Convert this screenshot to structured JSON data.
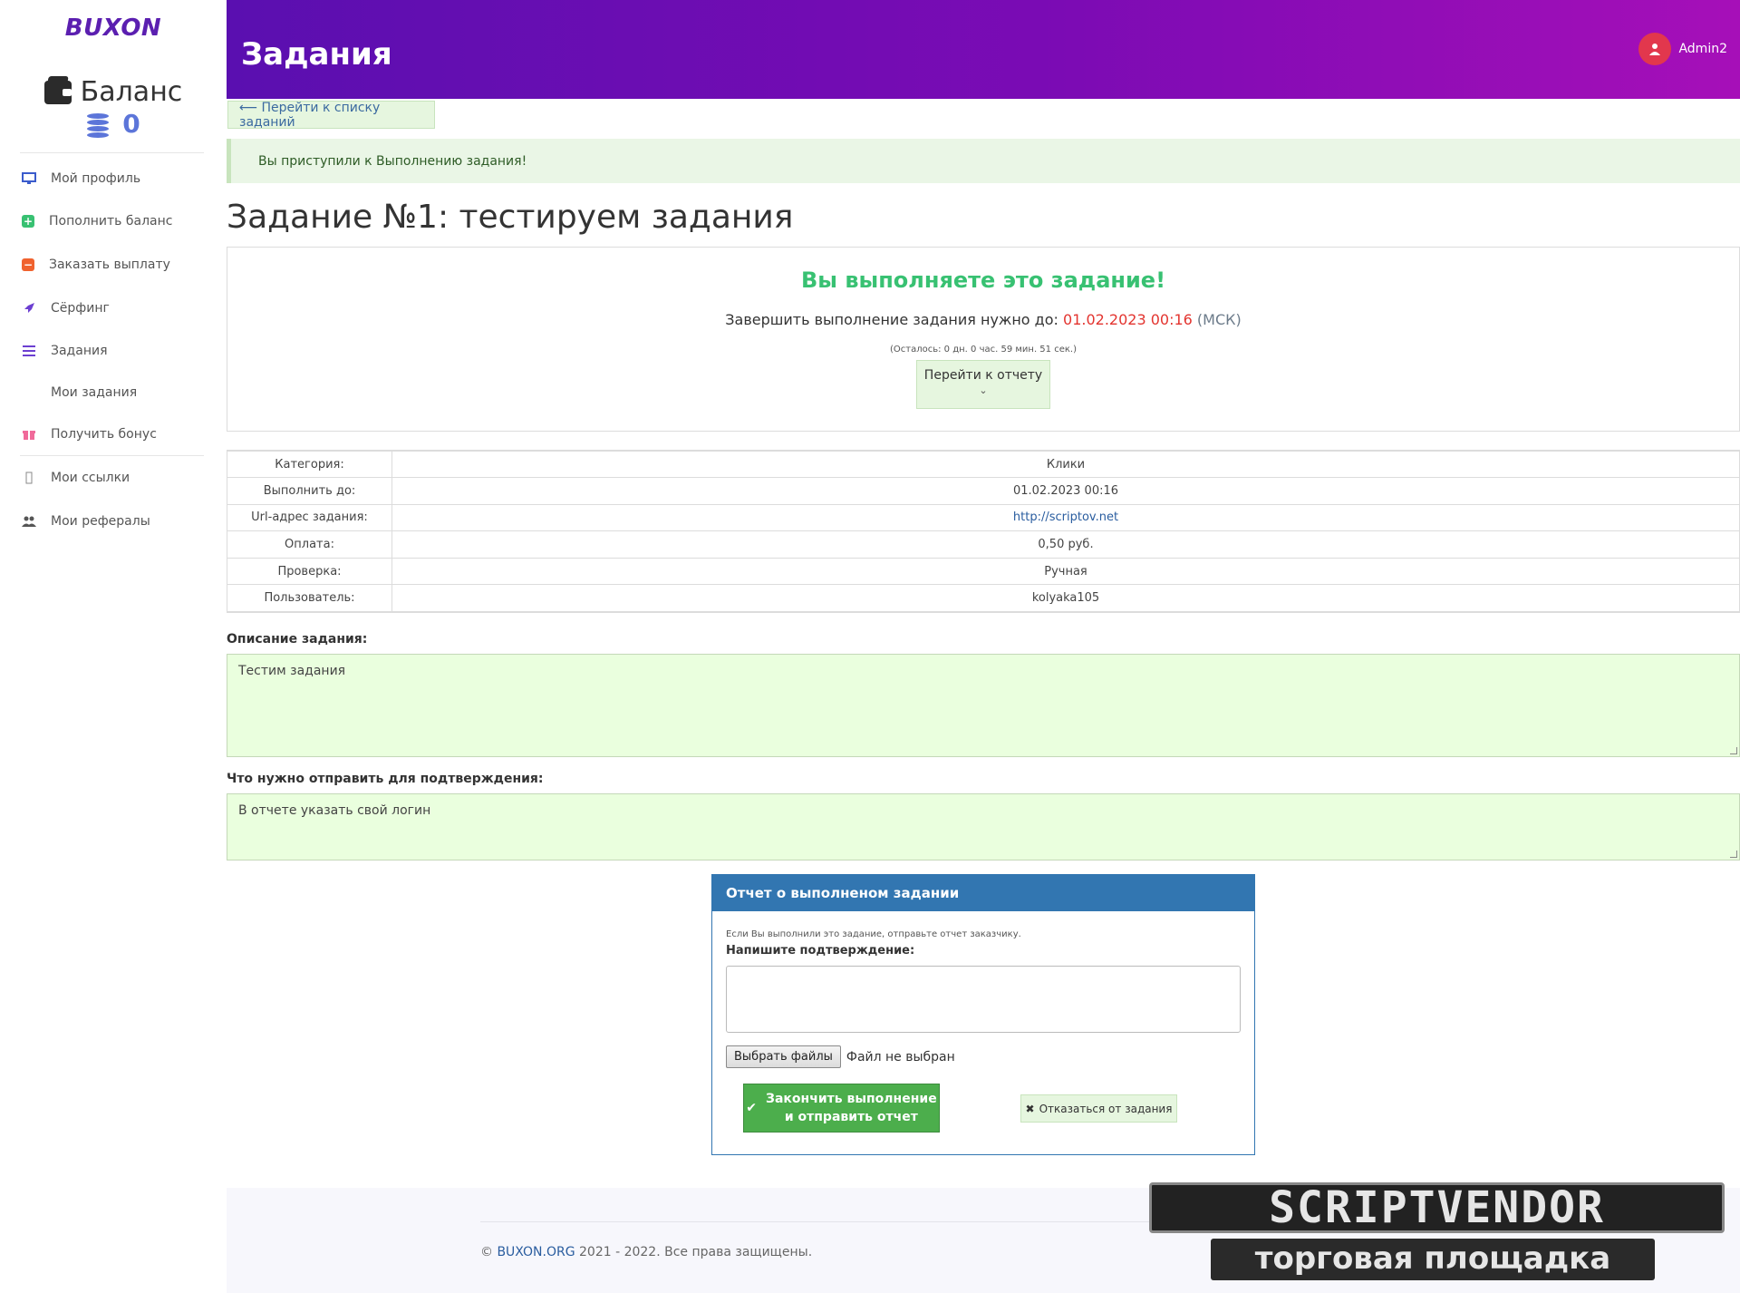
{
  "brand": {
    "logo": "BUXON"
  },
  "balance": {
    "title": "Баланс",
    "value": "0"
  },
  "sidebar": {
    "items": [
      {
        "label": "Мой профиль",
        "icon": "monitor-icon",
        "color": "#3b5ccc"
      },
      {
        "label": "Пополнить баланс",
        "icon": "plus-square-icon",
        "color": "#38c172"
      },
      {
        "label": "Заказать выплату",
        "icon": "minus-square-icon",
        "color": "#f0622e"
      },
      {
        "label": "Сёрфинг",
        "icon": "rocket-icon",
        "color": "#6c3fd1"
      },
      {
        "label": "Задания",
        "icon": "list-icon",
        "color": "#6c3fd1"
      },
      {
        "label": "Мои задания",
        "icon": "",
        "color": ""
      },
      {
        "label": "Получить бонус",
        "icon": "gift-icon",
        "color": "#f06a9a"
      },
      {
        "label": "Мои ссылки",
        "icon": "link-icon",
        "color": "#888888"
      },
      {
        "label": "Мои рефералы",
        "icon": "users-icon",
        "color": "#555555"
      }
    ]
  },
  "header": {
    "title": "Задания",
    "user": "Admin2"
  },
  "back_link": "⟵ Перейти к списку заданий",
  "alert": "Вы приступили к Выполнению задания!",
  "task": {
    "title": "Задание №1: тестируем задания",
    "status": "Вы выполняете это задание!",
    "deadline_prefix": "Завершить выполнение задания нужно до:",
    "deadline": "01.02.2023 00:16",
    "tz": "(МСК)",
    "remaining": "(Осталось: 0 дн. 0 час.  59 мин.  51 сек.)",
    "report_link": "Перейти к отчету"
  },
  "info_table": [
    {
      "key": "Категория:",
      "value": "Клики"
    },
    {
      "key": "Выполнить до:",
      "value": "01.02.2023 00:16"
    },
    {
      "key": "Url-адрес задания:",
      "value": "http://scriptov.net"
    },
    {
      "key": "Оплата:",
      "value": "0,50 руб."
    },
    {
      "key": "Проверка:",
      "value": "Ручная"
    },
    {
      "key": "Пользователь:",
      "value": "kolyaka105"
    }
  ],
  "description": {
    "label": "Описание задания:",
    "text": "Тестим задания"
  },
  "confirmation": {
    "label": "Что нужно отправить для подтверждения:",
    "text": "В отчете указать свой логин"
  },
  "report": {
    "title": "Отчет о выполненом задании",
    "hint": "Если Вы выполнили это задание, отправьте отчет заказчику.",
    "label": "Напишите подтверждение:",
    "file_button": "Выбрать файлы",
    "file_status": "Файл не выбран",
    "finish_line1": "Закончить выполнение",
    "finish_line2": "и отправить отчет",
    "refuse": "Отказаться от задания"
  },
  "footer": {
    "prefix": "©",
    "link": "BUXON.ORG",
    "text": "2021 - 2022. Все права защищены."
  },
  "watermark": {
    "top": "SCRIPTVENDOR",
    "bottom": "торговая площадка"
  }
}
